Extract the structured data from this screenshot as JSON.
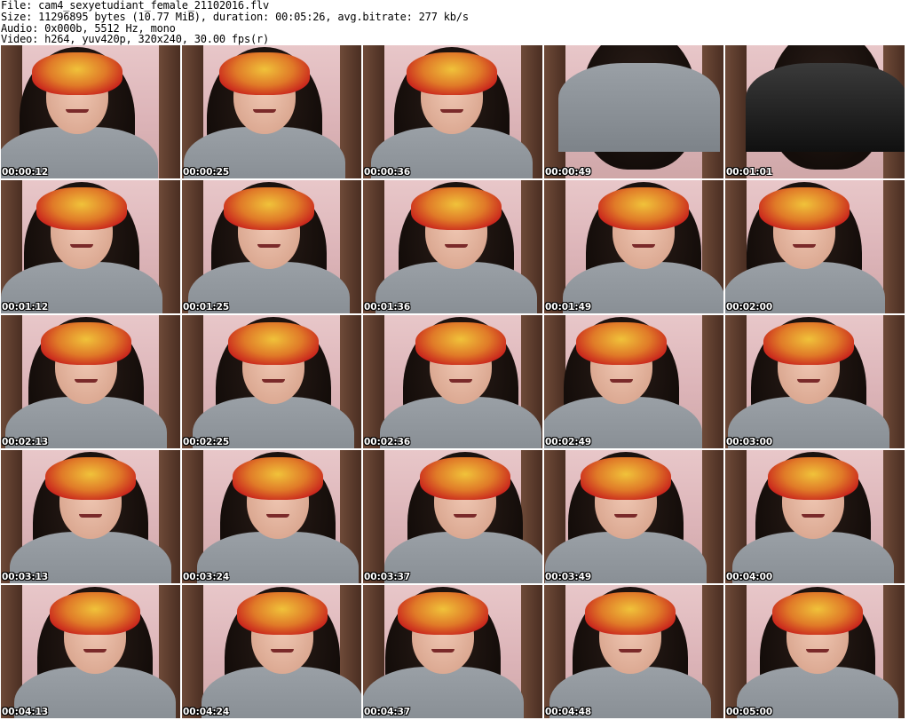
{
  "header": {
    "file": "File: cam4_sexyetudiant_female_21102016.flv",
    "size": "Size: 11296895 bytes (10.77 MiB), duration: 00:05:26, avg.bitrate: 277 kb/s",
    "audio": "Audio: 0x000b, 5512 Hz, mono",
    "video": "Video: h264, yuv420p, 320x240, 30.00 fps(r)"
  },
  "thumbnails": [
    "00:00:12",
    "00:00:25",
    "00:00:36",
    "00:00:49",
    "00:01:01",
    "00:01:12",
    "00:01:25",
    "00:01:36",
    "00:01:49",
    "00:02:00",
    "00:02:13",
    "00:02:25",
    "00:02:36",
    "00:02:49",
    "00:03:00",
    "00:03:13",
    "00:03:24",
    "00:03:37",
    "00:03:49",
    "00:04:00",
    "00:04:13",
    "00:04:24",
    "00:04:37",
    "00:04:48",
    "00:05:00"
  ],
  "colors": {
    "background": "#ffffff",
    "timestamp_text": "#ffffff",
    "wall": "#e0bbbe",
    "sweater": "#8a9096",
    "mask_gold": "#f0c23a",
    "mask_red": "#c8201c"
  }
}
